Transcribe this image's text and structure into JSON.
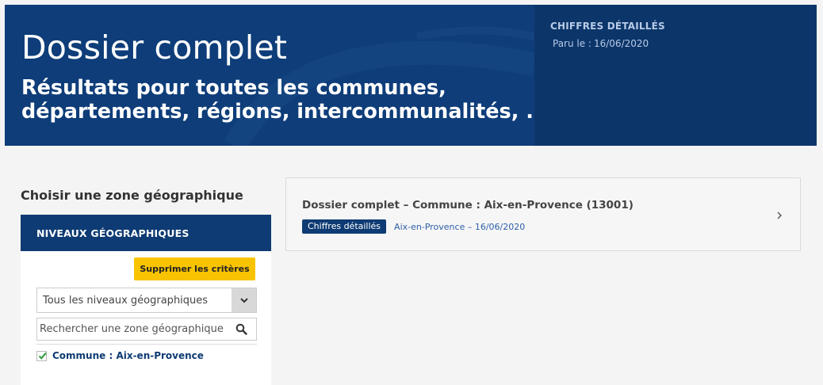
{
  "banner": {
    "title": "Dossier complet",
    "subtitle_line1": "Résultats pour toutes les communes,",
    "subtitle_line2": "départements, régions, intercommunalités, ...",
    "side_kicker": "CHIFFRES DÉTAILLÉS",
    "side_date_label": "Paru le :",
    "side_date_value": "16/06/2020"
  },
  "filters": {
    "heading": "Choisir une zone géographique",
    "panel_title": "NIVEAUX GÉOGRAPHIQUES",
    "clear_label": "Supprimer les critères",
    "level_select_value": "Tous les niveaux géographiques",
    "search_placeholder": "Rechercher une zone géographique",
    "selected_zone_label": "Commune : Aix-en-Provence",
    "selected_zone_checked": true
  },
  "results": [
    {
      "title": "Dossier complet – Commune : Aix-en-Provence (13001)",
      "tag": "Chiffres détaillés",
      "meta": "Aix-en-Provence – 16/06/2020"
    }
  ],
  "colors": {
    "brand_navy": "#0e3b73",
    "accent_yellow": "#f8c300",
    "check_green": "#3aa14a"
  },
  "icons": {
    "select_arrow": "chevron-down-icon",
    "search": "search-icon",
    "check": "check-icon",
    "result_arrow": "chevron-right-icon"
  }
}
